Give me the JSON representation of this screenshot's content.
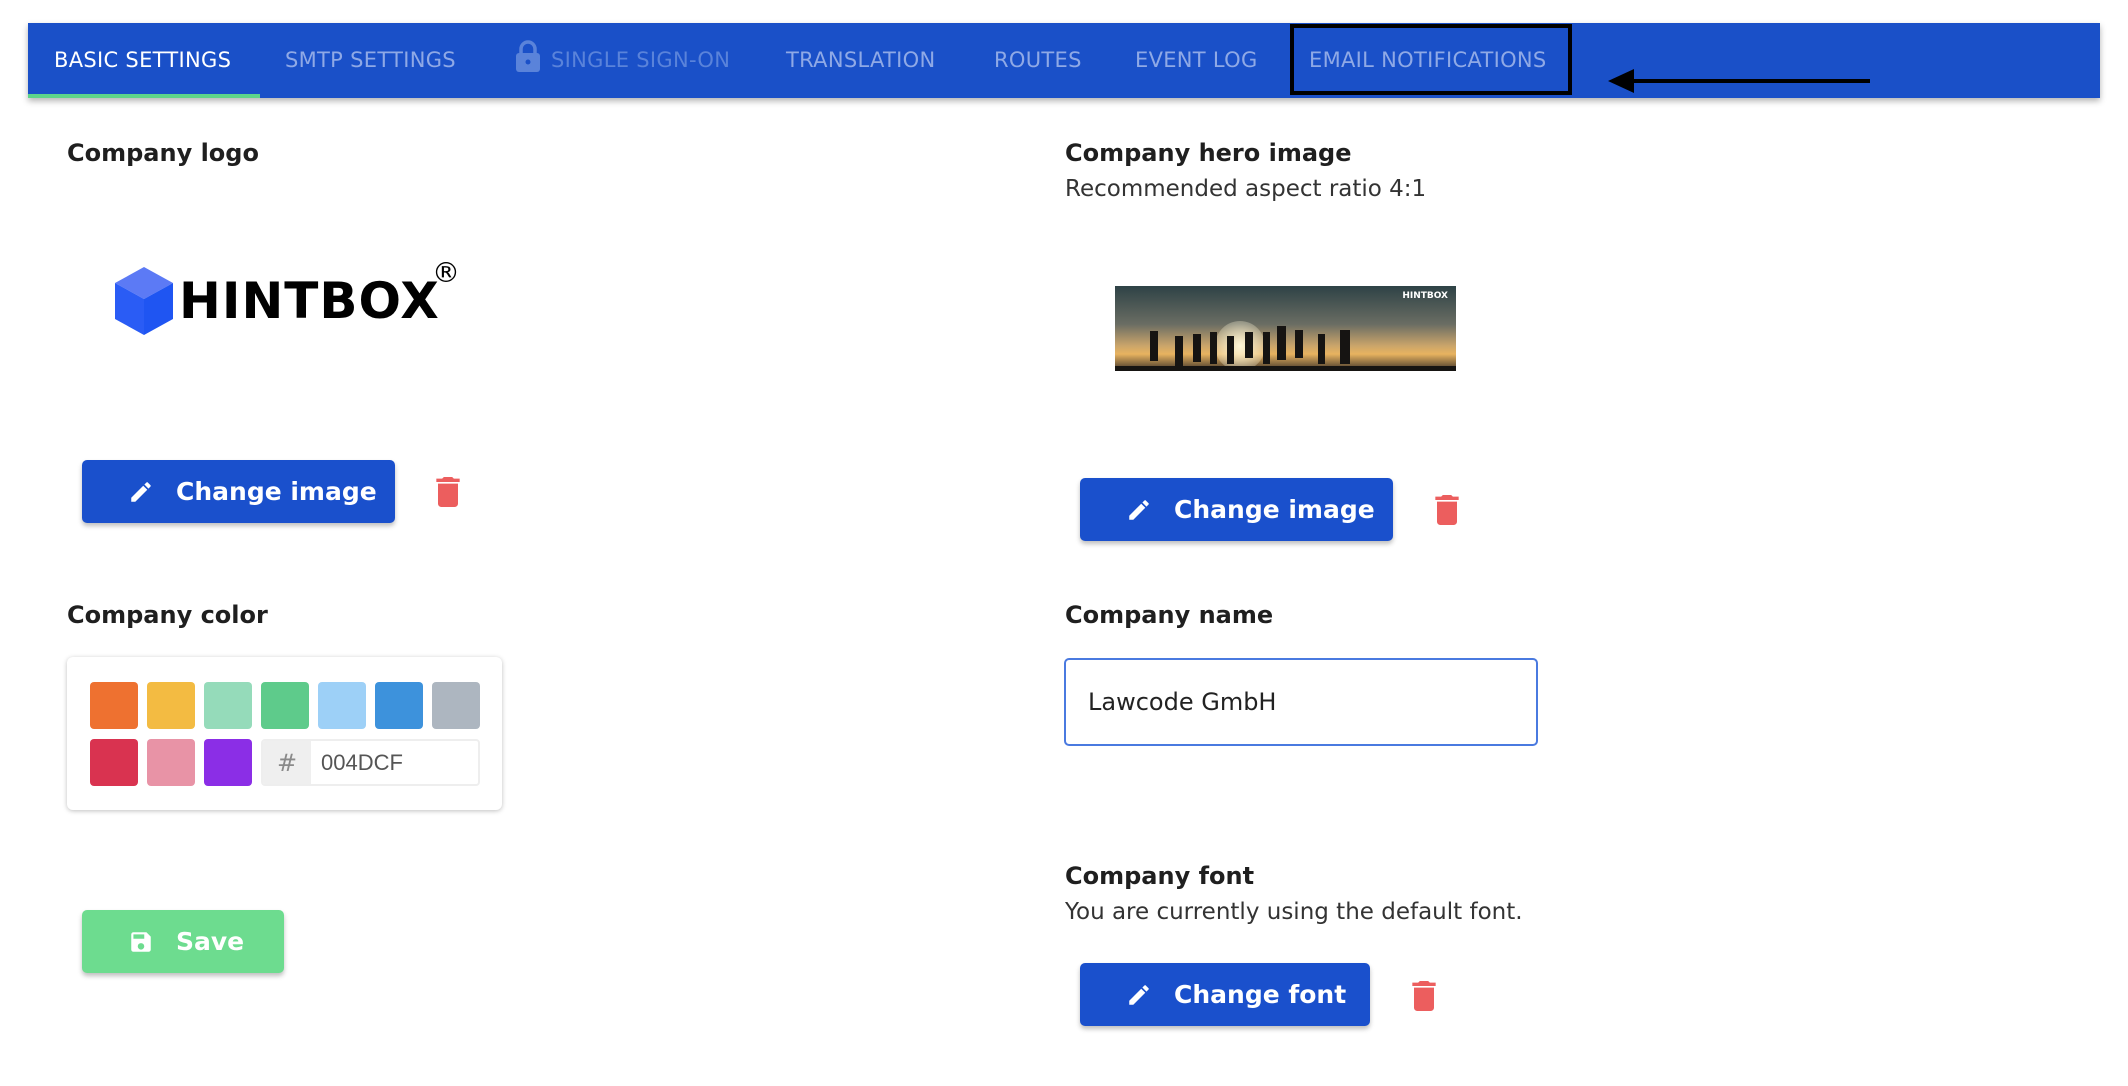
{
  "tabs": [
    {
      "label": "BASIC SETTINGS",
      "state": "active"
    },
    {
      "label": "SMTP SETTINGS",
      "state": "normal"
    },
    {
      "label": "SINGLE SIGN-ON",
      "state": "disabled",
      "icon": "lock-icon"
    },
    {
      "label": "TRANSLATION",
      "state": "normal"
    },
    {
      "label": "ROUTES",
      "state": "normal"
    },
    {
      "label": "EVENT LOG",
      "state": "normal"
    },
    {
      "label": "EMAIL NOTIFICATIONS",
      "state": "normal",
      "highlighted": true
    }
  ],
  "logo": {
    "label": "Company logo",
    "brand": "HINTBOX",
    "registered": "®",
    "change_label": "Change image"
  },
  "hero": {
    "label": "Company hero image",
    "hint": "Recommended aspect ratio 4:1",
    "brand": "HINTBOX",
    "change_label": "Change image"
  },
  "color": {
    "label": "Company color",
    "swatches": [
      "#ee7130",
      "#f3bb42",
      "#95dbba",
      "#5ecb8b",
      "#9dd0f7",
      "#3d92dc",
      "#adb6c0",
      "#d93350",
      "#e893a6",
      "#8b2ee6"
    ],
    "hash": "#",
    "value": "004DCF"
  },
  "name": {
    "label": "Company name",
    "value": "Lawcode GmbH"
  },
  "font": {
    "label": "Company font",
    "hint": "You are currently using the default font.",
    "change_label": "Change font"
  },
  "save_label": "Save",
  "colors": {
    "nav": "#1a50c8",
    "button": "#1a50cc",
    "save": "#6ddc8f",
    "trash": "#ec5e5e",
    "active_underline": "#5ed48a"
  }
}
